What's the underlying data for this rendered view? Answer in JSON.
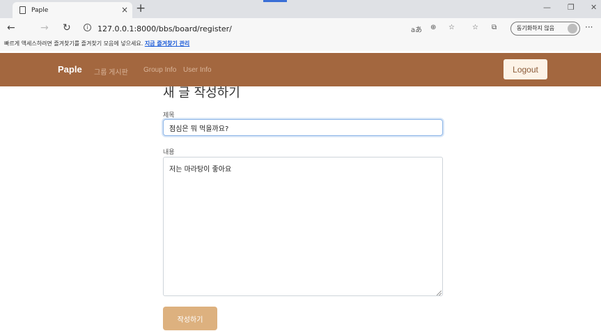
{
  "browser": {
    "tab_title": "Paple",
    "tab_close": "×",
    "new_tab": "+",
    "url": "127.0.0.1:8000/bbs/board/register/",
    "sync_label": "동기화하지 않음",
    "favorites_prompt": "빠르게 액세스하려면 즐겨찾기를 즐겨찾기 모음에 넣으세요.",
    "favorites_link": "지금 즐겨찾기 관리",
    "icons": [
      "page-icon",
      "back-arrow-icon",
      "forward-arrow-icon",
      "refresh-icon",
      "info-icon",
      "read-aloud-icon",
      "zoom-icon",
      "add-favorite-icon",
      "favorites-icon",
      "collections-icon",
      "profile-icon",
      "more-icon",
      "minimize-icon",
      "restore-icon",
      "close-icon"
    ]
  },
  "navbar": {
    "brand": "Paple",
    "links": [
      "그룹 게시판",
      "Group Info",
      "User Info"
    ],
    "logout": "Logout",
    "color": "#a3673f"
  },
  "form": {
    "heading": "새 글 작성하기",
    "title_label": "제목",
    "title_value": "점심은 뭐 먹을까요?",
    "content_label": "내용",
    "content_value": "저는 마라탕이 좋아요",
    "submit_label": "작성하기",
    "submit_color": "#ddb17f"
  }
}
